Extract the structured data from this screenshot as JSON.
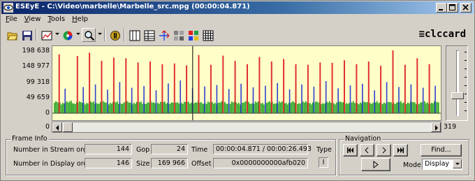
{
  "window": {
    "title": "ESEyE - C:\\Video\\marbelle\\Marbelle_src.mpg (00:00:04.871)",
    "minimize_icon": "minimize-icon",
    "maximize_icon": "maximize-icon",
    "close_icon": "close-icon"
  },
  "menu": {
    "items": [
      {
        "label": "File",
        "accel": "F",
        "rest": "ile"
      },
      {
        "label": "View",
        "accel": "V",
        "rest": "iew"
      },
      {
        "label": "Tools",
        "accel": "T",
        "rest": "ools"
      },
      {
        "label": "Help",
        "accel": "H",
        "rest": "elp"
      }
    ]
  },
  "toolbar": {
    "icons": [
      "open-folder-icon",
      "save-icon",
      "chart-icon",
      "color-wheel-icon",
      "zoom-icon",
      "record-icon",
      "frame-grid-icon",
      "table-icon",
      "arrows-icon",
      "macroblock-gray-icon",
      "macroblock-color-icon",
      "grid-icon"
    ],
    "logo": "≡clccard"
  },
  "chart": {
    "y_labels": [
      "198 638",
      "148 977",
      "99 318",
      "49 659",
      "0"
    ],
    "scroll_min": "0",
    "scroll_max": "319"
  },
  "chart_data": {
    "type": "bar",
    "ylim": [
      0,
      198638
    ],
    "series": [
      {
        "name": "I",
        "color": "#e03030"
      },
      {
        "name": "P",
        "color": "#3040d0"
      },
      {
        "name": "B",
        "color": "#20a020"
      }
    ],
    "bars": [
      {
        "t": "I",
        "v": 180000
      },
      {
        "t": "P",
        "v": 75000
      },
      {
        "t": "B",
        "v": 38000
      },
      {
        "t": "I",
        "v": 175000
      },
      {
        "t": "P",
        "v": 80000
      },
      {
        "t": "I",
        "v": 185000
      },
      {
        "t": "P",
        "v": 88000
      },
      {
        "t": "I",
        "v": 160000
      },
      {
        "t": "P",
        "v": 72000
      },
      {
        "t": "I",
        "v": 170000
      },
      {
        "t": "P",
        "v": 95000
      },
      {
        "t": "I",
        "v": 168000
      },
      {
        "t": "P",
        "v": 78000
      },
      {
        "t": "I",
        "v": 155000
      },
      {
        "t": "P",
        "v": 83000
      },
      {
        "t": "I",
        "v": 158000
      },
      {
        "t": "P",
        "v": 70000
      },
      {
        "t": "I",
        "v": 150000
      },
      {
        "t": "P",
        "v": 91000
      },
      {
        "t": "I",
        "v": 152000
      },
      {
        "t": "P",
        "v": 100000
      },
      {
        "t": "I",
        "v": 146000
      },
      {
        "t": "P",
        "v": 76000
      },
      {
        "t": "I",
        "v": 178000
      },
      {
        "t": "P",
        "v": 82000
      },
      {
        "t": "I",
        "v": 148000
      },
      {
        "t": "P",
        "v": 86000
      },
      {
        "t": "I",
        "v": 176000
      },
      {
        "t": "P",
        "v": 74000
      },
      {
        "t": "I",
        "v": 160000
      },
      {
        "t": "P",
        "v": 90000
      },
      {
        "t": "I",
        "v": 150000
      },
      {
        "t": "P",
        "v": 79000
      },
      {
        "t": "I",
        "v": 172000
      },
      {
        "t": "P",
        "v": 84000
      },
      {
        "t": "I",
        "v": 158000
      },
      {
        "t": "P",
        "v": 92000
      },
      {
        "t": "I",
        "v": 166000
      },
      {
        "t": "P",
        "v": 73000
      },
      {
        "t": "I",
        "v": 150000
      },
      {
        "t": "P",
        "v": 88000
      },
      {
        "t": "I",
        "v": 148000
      },
      {
        "t": "P",
        "v": 81000
      },
      {
        "t": "I",
        "v": 155000
      },
      {
        "t": "P",
        "v": 98000
      },
      {
        "t": "I",
        "v": 154000
      },
      {
        "t": "P",
        "v": 76000
      },
      {
        "t": "I",
        "v": 162000
      },
      {
        "t": "P",
        "v": 85000
      },
      {
        "t": "I",
        "v": 150000
      },
      {
        "t": "P",
        "v": 90000
      },
      {
        "t": "I",
        "v": 158000
      },
      {
        "t": "P",
        "v": 70000
      },
      {
        "t": "I",
        "v": 145000
      },
      {
        "t": "P",
        "v": 95000
      },
      {
        "t": "I",
        "v": 192000
      },
      {
        "t": "P",
        "v": 80000
      },
      {
        "t": "I",
        "v": 148000
      },
      {
        "t": "P",
        "v": 88000
      },
      {
        "t": "I",
        "v": 168000
      },
      {
        "t": "P",
        "v": 78000
      },
      {
        "t": "I",
        "v": 150000
      },
      {
        "t": "P",
        "v": 84000
      }
    ],
    "b_level": 32000,
    "cursor_index": 22
  },
  "frame_info": {
    "title": "Frame Info",
    "stream_order_label": "Number in Stream order",
    "stream_order_value": "144",
    "display_order_label": "Number in Display order",
    "display_order_value": "146",
    "gop_label": "Gop",
    "gop_value": "24",
    "size_label": "Size",
    "size_value": "169 966",
    "time_label": "Time",
    "time_value": "00:00:04.871 / 00:00:26.493",
    "offset_label": "Offset",
    "offset_value": "0x0000000000afb020",
    "type_label": "Type",
    "type_value": "I"
  },
  "navigation": {
    "title": "Navigation",
    "buttons": [
      "first-frame-icon",
      "prev-frame-icon",
      "next-frame-icon",
      "last-frame-icon"
    ],
    "play_icon": "play-icon",
    "find_label": "Find...",
    "mode_label": "Mode",
    "mode_value": "Display"
  }
}
